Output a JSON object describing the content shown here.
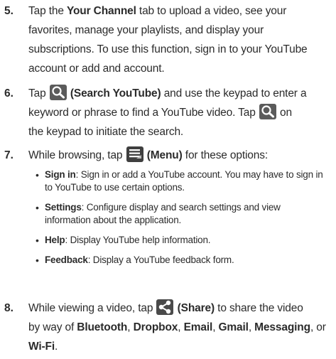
{
  "steps": [
    {
      "number": "5.",
      "lines": [
        [
          "Tap the ",
          "Your Channel",
          " tab to upload a video, see your"
        ],
        [
          "favorites, manage your playlists, and display your"
        ],
        [
          "subscriptions. To use this function, sign in to your YouTube"
        ],
        [
          "account or add and account."
        ]
      ]
    },
    {
      "number": "6.",
      "line1_pre": "Tap ",
      "line1_bold": "(Search YouTube)",
      "line1_post": " and use the keypad to enter a",
      "line2_pre": "keyword or phrase to find a YouTube video. Tap ",
      "line2_post": " on",
      "line3": "the keypad to initiate the search."
    },
    {
      "number": "7.",
      "line1_pre": "While browsing, tap ",
      "line1_bold": "(Menu)",
      "line1_post": " for these options:",
      "bullets": [
        {
          "term": "Sign in",
          "text": ": Sign in or add a YouTube account. You may have to sign in",
          "text2": "to YouTube to use certain options."
        },
        {
          "term": "Settings",
          "text": ": Configure display and search settings and view",
          "text2": "information about the application."
        },
        {
          "term": "Help",
          "text": ": Display YouTube help information.",
          "text2": ""
        },
        {
          "term": "Feedback",
          "text": ": Display a YouTube feedback form.",
          "text2": ""
        }
      ]
    },
    {
      "number": "8.",
      "line1_pre": "While viewing a video, tap ",
      "line1_bold": "(Share)",
      "line1_post": " to share the video",
      "line2_pre": "by way of ",
      "apps": [
        "Bluetooth",
        "Dropbox",
        "Email",
        "Gmail",
        "Messaging",
        "Wi-Fi"
      ],
      "sep": ", ",
      "or": " or",
      "period": "."
    }
  ],
  "icons": {
    "search": "magnifier-icon",
    "menu": "menu-list-icon",
    "share": "share-icon",
    "icon_color": "#505050"
  }
}
